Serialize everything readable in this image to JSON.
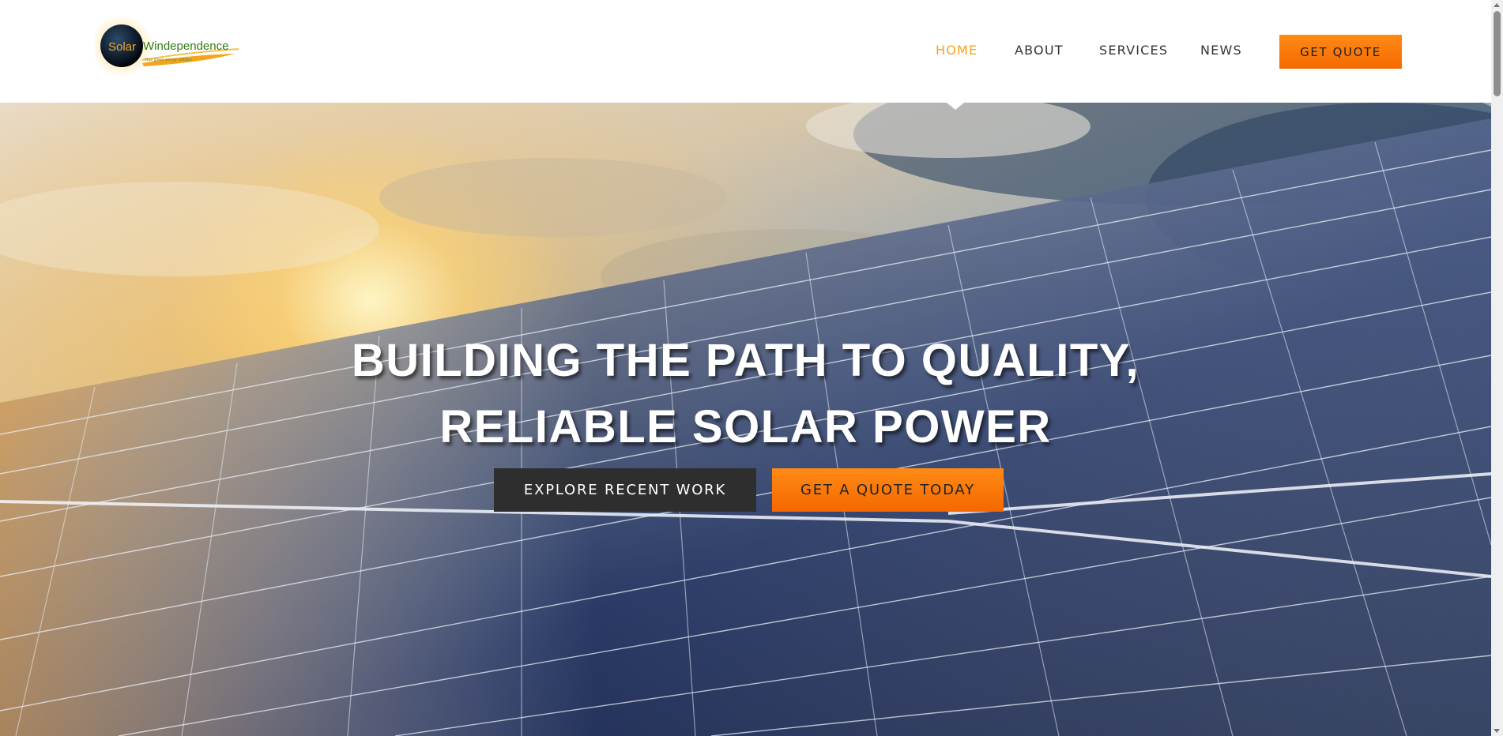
{
  "brand": {
    "logo_word_1": "Solar",
    "logo_word_2": "Windependence",
    "logo_tagline": "Your green energy solution",
    "colors": {
      "accent": "#f7a21b",
      "button_orange": "#f56a00",
      "logo_green": "#2e7d12"
    }
  },
  "nav": {
    "items": [
      {
        "label": "HOME",
        "active": true
      },
      {
        "label": "ABOUT",
        "active": false
      },
      {
        "label": "SERVICES",
        "active": false
      },
      {
        "label": "NEWS",
        "active": false
      }
    ],
    "cta_label": "GET QUOTE"
  },
  "hero": {
    "title_line_1": "BUILDING THE PATH TO QUALITY,",
    "title_line_2": "RELIABLE SOLAR POWER",
    "primary_button": "EXPLORE RECENT WORK",
    "secondary_button": "GET A QUOTE TODAY",
    "background": "solar panels under sunset sky"
  }
}
